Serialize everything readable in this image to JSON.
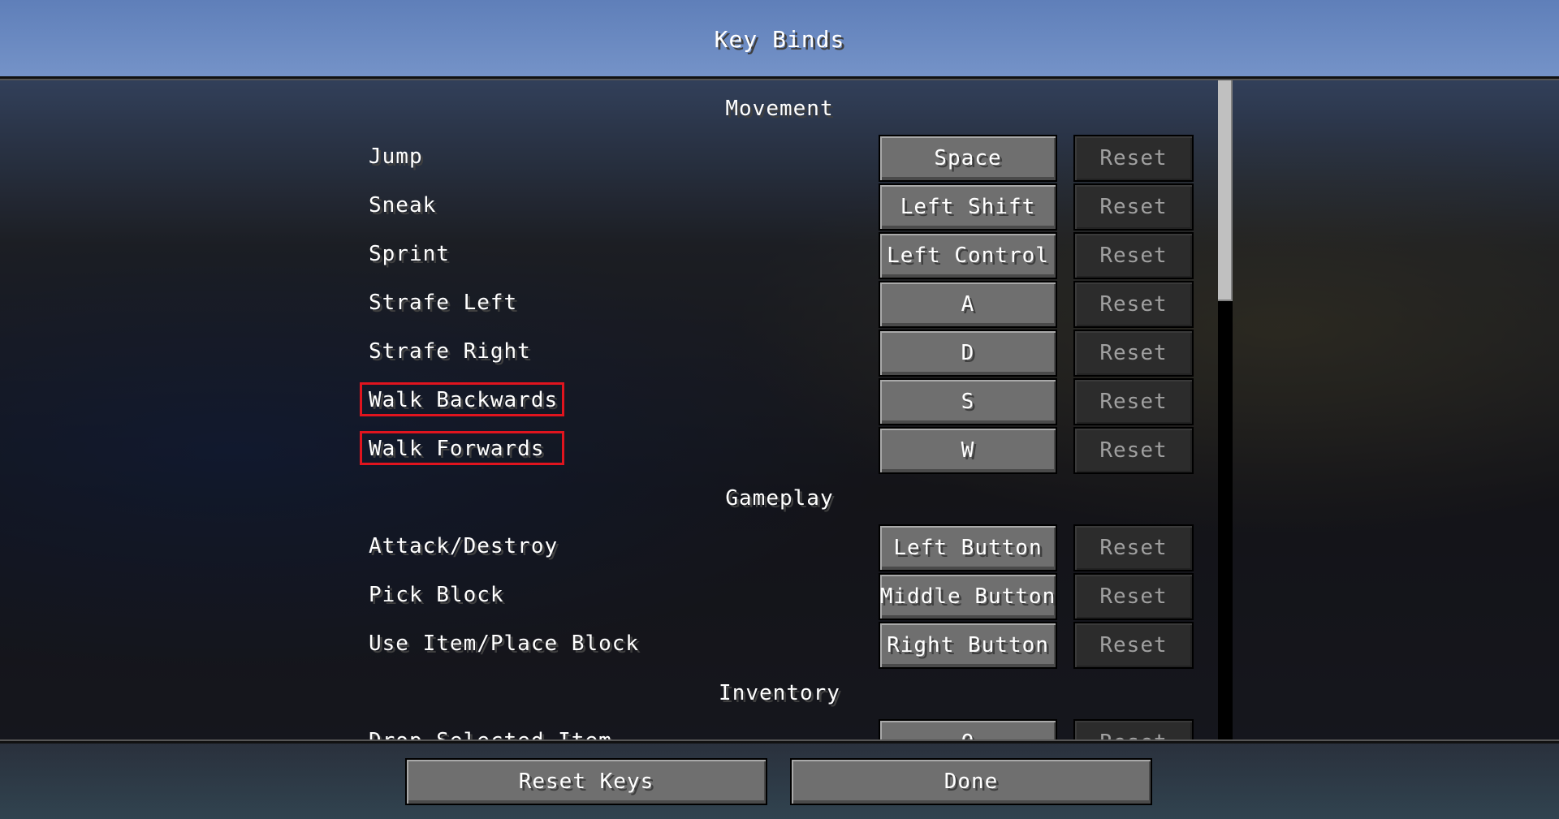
{
  "screen": {
    "title": "Key Binds"
  },
  "categories": {
    "movement": "Movement",
    "gameplay": "Gameplay",
    "inventory": "Inventory"
  },
  "movement_binds": [
    {
      "label": "Jump",
      "key": "Space",
      "reset": "Reset"
    },
    {
      "label": "Sneak",
      "key": "Left Shift",
      "reset": "Reset"
    },
    {
      "label": "Sprint",
      "key": "Left Control",
      "reset": "Reset"
    },
    {
      "label": "Strafe Left",
      "key": "A",
      "reset": "Reset"
    },
    {
      "label": "Strafe Right",
      "key": "D",
      "reset": "Reset"
    },
    {
      "label": "Walk Backwards",
      "key": "S",
      "reset": "Reset",
      "highlighted": true
    },
    {
      "label": "Walk Forwards",
      "key": "W",
      "reset": "Reset",
      "highlighted": true
    }
  ],
  "gameplay_binds": [
    {
      "label": "Attack/Destroy",
      "key": "Left Button",
      "reset": "Reset"
    },
    {
      "label": "Pick Block",
      "key": "Middle Button",
      "reset": "Reset"
    },
    {
      "label": "Use Item/Place Block",
      "key": "Right Button",
      "reset": "Reset"
    }
  ],
  "inventory_binds": [
    {
      "label": "Drop Selected Item",
      "key": "Q",
      "reset": "Reset"
    }
  ],
  "footer": {
    "reset_keys_label": "Reset Keys",
    "done_label": "Done"
  },
  "colors": {
    "highlight": "#e0141e",
    "button_face": "#6f6f6f",
    "reset_disabled_face": "#2c2c2c",
    "text": "#ffffff",
    "disabled_text": "#a0a0a0"
  }
}
